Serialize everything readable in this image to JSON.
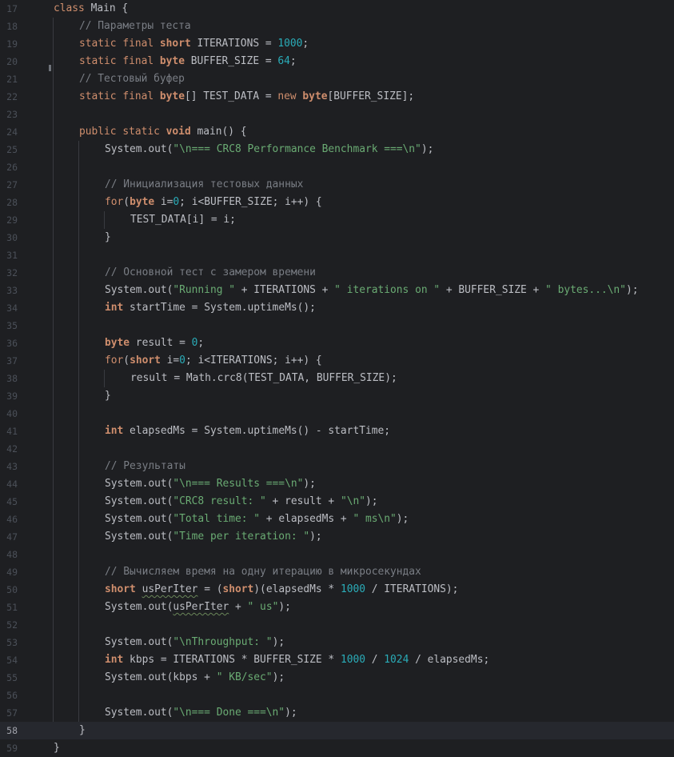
{
  "editor": {
    "colors": {
      "background": "#1e1f22",
      "current_line": "#26282e",
      "keyword": "#cf8e6d",
      "string": "#6aab73",
      "number": "#2aacb8",
      "comment": "#7a7e85",
      "text": "#bcbec4",
      "gutter": "#4b5059"
    },
    "current_line": 58,
    "lines": [
      {
        "no": "17",
        "indent": 0,
        "tokens": [
          [
            "kw",
            "class"
          ],
          [
            "id",
            " Main {"
          ]
        ]
      },
      {
        "no": "18",
        "indent": 1,
        "tokens": [
          [
            "cmt",
            "// Параметры теста"
          ]
        ]
      },
      {
        "no": "19",
        "indent": 1,
        "tokens": [
          [
            "kw",
            "static final "
          ],
          [
            "kwb",
            "short"
          ],
          [
            "id",
            " ITERATIONS = "
          ],
          [
            "num",
            "1000"
          ],
          [
            "id",
            ";"
          ]
        ]
      },
      {
        "no": "20",
        "indent": 1,
        "tokens": [
          [
            "kw",
            "static final "
          ],
          [
            "kwb",
            "byte"
          ],
          [
            "id",
            " BUFFER_SIZE = "
          ],
          [
            "num",
            "64"
          ],
          [
            "id",
            ";"
          ]
        ]
      },
      {
        "no": "21",
        "indent": 1,
        "tokens": [
          [
            "cmt",
            "// Тестовый буфер"
          ]
        ]
      },
      {
        "no": "22",
        "indent": 1,
        "tokens": [
          [
            "kw",
            "static final "
          ],
          [
            "kwb",
            "byte"
          ],
          [
            "id",
            "[] TEST_DATA = "
          ],
          [
            "kw",
            "new "
          ],
          [
            "kwb",
            "byte"
          ],
          [
            "id",
            "[BUFFER_SIZE];"
          ]
        ]
      },
      {
        "no": "23",
        "indent": 0,
        "tokens": []
      },
      {
        "no": "24",
        "indent": 1,
        "tokens": [
          [
            "kw",
            "public static "
          ],
          [
            "kwb",
            "void"
          ],
          [
            "id",
            " main() {"
          ]
        ]
      },
      {
        "no": "25",
        "indent": 2,
        "tokens": [
          [
            "id",
            "System.out("
          ],
          [
            "str",
            "\"\\n=== CRC8 Performance Benchmark ===\\n\""
          ],
          [
            "id",
            ");"
          ]
        ]
      },
      {
        "no": "26",
        "indent": 0,
        "tokens": []
      },
      {
        "no": "27",
        "indent": 2,
        "tokens": [
          [
            "cmt",
            "// Инициализация тестовых данных"
          ]
        ]
      },
      {
        "no": "28",
        "indent": 2,
        "tokens": [
          [
            "kw",
            "for"
          ],
          [
            "id",
            "("
          ],
          [
            "kwb",
            "byte"
          ],
          [
            "id",
            " i="
          ],
          [
            "num",
            "0"
          ],
          [
            "id",
            "; i<BUFFER_SIZE; i++) {"
          ]
        ]
      },
      {
        "no": "29",
        "indent": 3,
        "tokens": [
          [
            "id",
            "TEST_DATA[i] = i;"
          ]
        ]
      },
      {
        "no": "30",
        "indent": 2,
        "tokens": [
          [
            "id",
            "}"
          ]
        ]
      },
      {
        "no": "31",
        "indent": 0,
        "tokens": []
      },
      {
        "no": "32",
        "indent": 2,
        "tokens": [
          [
            "cmt",
            "// Основной тест с замером времени"
          ]
        ]
      },
      {
        "no": "33",
        "indent": 2,
        "tokens": [
          [
            "id",
            "System.out("
          ],
          [
            "str",
            "\"Running \""
          ],
          [
            "id",
            " + ITERATIONS + "
          ],
          [
            "str",
            "\" iterations on \""
          ],
          [
            "id",
            " + BUFFER_SIZE + "
          ],
          [
            "str",
            "\" bytes...\\n\""
          ],
          [
            "id",
            ");"
          ]
        ]
      },
      {
        "no": "34",
        "indent": 2,
        "tokens": [
          [
            "kwb",
            "int"
          ],
          [
            "id",
            " startTime = System.uptimeMs();"
          ]
        ]
      },
      {
        "no": "35",
        "indent": 0,
        "tokens": []
      },
      {
        "no": "36",
        "indent": 2,
        "tokens": [
          [
            "kwb",
            "byte"
          ],
          [
            "id",
            " result = "
          ],
          [
            "num",
            "0"
          ],
          [
            "id",
            ";"
          ]
        ]
      },
      {
        "no": "37",
        "indent": 2,
        "tokens": [
          [
            "kw",
            "for"
          ],
          [
            "id",
            "("
          ],
          [
            "kwb",
            "short"
          ],
          [
            "id",
            " i="
          ],
          [
            "num",
            "0"
          ],
          [
            "id",
            "; i<ITERATIONS; i++) {"
          ]
        ]
      },
      {
        "no": "38",
        "indent": 3,
        "tokens": [
          [
            "id",
            "result = Math.crc8(TEST_DATA, BUFFER_SIZE);"
          ]
        ]
      },
      {
        "no": "39",
        "indent": 2,
        "tokens": [
          [
            "id",
            "}"
          ]
        ]
      },
      {
        "no": "40",
        "indent": 0,
        "tokens": []
      },
      {
        "no": "41",
        "indent": 2,
        "tokens": [
          [
            "kwb",
            "int"
          ],
          [
            "id",
            " elapsedMs = System.uptimeMs() - startTime;"
          ]
        ]
      },
      {
        "no": "42",
        "indent": 0,
        "tokens": []
      },
      {
        "no": "43",
        "indent": 2,
        "tokens": [
          [
            "cmt",
            "// Результаты"
          ]
        ]
      },
      {
        "no": "44",
        "indent": 2,
        "tokens": [
          [
            "id",
            "System.out("
          ],
          [
            "str",
            "\"\\n=== Results ===\\n\""
          ],
          [
            "id",
            ");"
          ]
        ]
      },
      {
        "no": "45",
        "indent": 2,
        "tokens": [
          [
            "id",
            "System.out("
          ],
          [
            "str",
            "\"CRC8 result: \""
          ],
          [
            "id",
            " + result + "
          ],
          [
            "str",
            "\"\\n\""
          ],
          [
            "id",
            ");"
          ]
        ]
      },
      {
        "no": "46",
        "indent": 2,
        "tokens": [
          [
            "id",
            "System.out("
          ],
          [
            "str",
            "\"Total time: \""
          ],
          [
            "id",
            " + elapsedMs + "
          ],
          [
            "str",
            "\" ms\\n\""
          ],
          [
            "id",
            ");"
          ]
        ]
      },
      {
        "no": "47",
        "indent": 2,
        "tokens": [
          [
            "id",
            "System.out("
          ],
          [
            "str",
            "\"Time per iteration: \""
          ],
          [
            "id",
            ");"
          ]
        ]
      },
      {
        "no": "48",
        "indent": 0,
        "tokens": []
      },
      {
        "no": "49",
        "indent": 2,
        "tokens": [
          [
            "cmt",
            "// Вычисляем время на одну итерацию в микросекундах"
          ]
        ]
      },
      {
        "no": "50",
        "indent": 2,
        "tokens": [
          [
            "kwb",
            "short"
          ],
          [
            "id",
            " "
          ],
          [
            "typo",
            "usPerIter"
          ],
          [
            "id",
            " = ("
          ],
          [
            "kwb",
            "short"
          ],
          [
            "id",
            ")(elapsedMs * "
          ],
          [
            "num",
            "1000"
          ],
          [
            "id",
            " / ITERATIONS);"
          ]
        ]
      },
      {
        "no": "51",
        "indent": 2,
        "tokens": [
          [
            "id",
            "System.out("
          ],
          [
            "typo",
            "usPerIter"
          ],
          [
            "id",
            " + "
          ],
          [
            "str",
            "\" us\""
          ],
          [
            "id",
            ");"
          ]
        ]
      },
      {
        "no": "52",
        "indent": 0,
        "tokens": []
      },
      {
        "no": "53",
        "indent": 2,
        "tokens": [
          [
            "id",
            "System.out("
          ],
          [
            "str",
            "\"\\nThroughput: \""
          ],
          [
            "id",
            ");"
          ]
        ]
      },
      {
        "no": "54",
        "indent": 2,
        "tokens": [
          [
            "kwb",
            "int"
          ],
          [
            "id",
            " kbps = ITERATIONS * BUFFER_SIZE * "
          ],
          [
            "num",
            "1000"
          ],
          [
            "id",
            " / "
          ],
          [
            "num",
            "1024"
          ],
          [
            "id",
            " / elapsedMs;"
          ]
        ]
      },
      {
        "no": "55",
        "indent": 2,
        "tokens": [
          [
            "id",
            "System.out(kbps + "
          ],
          [
            "str",
            "\" KB/sec\""
          ],
          [
            "id",
            ");"
          ]
        ]
      },
      {
        "no": "56",
        "indent": 0,
        "tokens": []
      },
      {
        "no": "57",
        "indent": 2,
        "tokens": [
          [
            "id",
            "System.out("
          ],
          [
            "str",
            "\"\\n=== Done ===\\n\""
          ],
          [
            "id",
            ");"
          ]
        ]
      },
      {
        "no": "58",
        "indent": 1,
        "tokens": [
          [
            "id",
            "}"
          ]
        ]
      },
      {
        "no": "59",
        "indent": 0,
        "tokens": [
          [
            "id",
            "}"
          ]
        ]
      }
    ]
  }
}
